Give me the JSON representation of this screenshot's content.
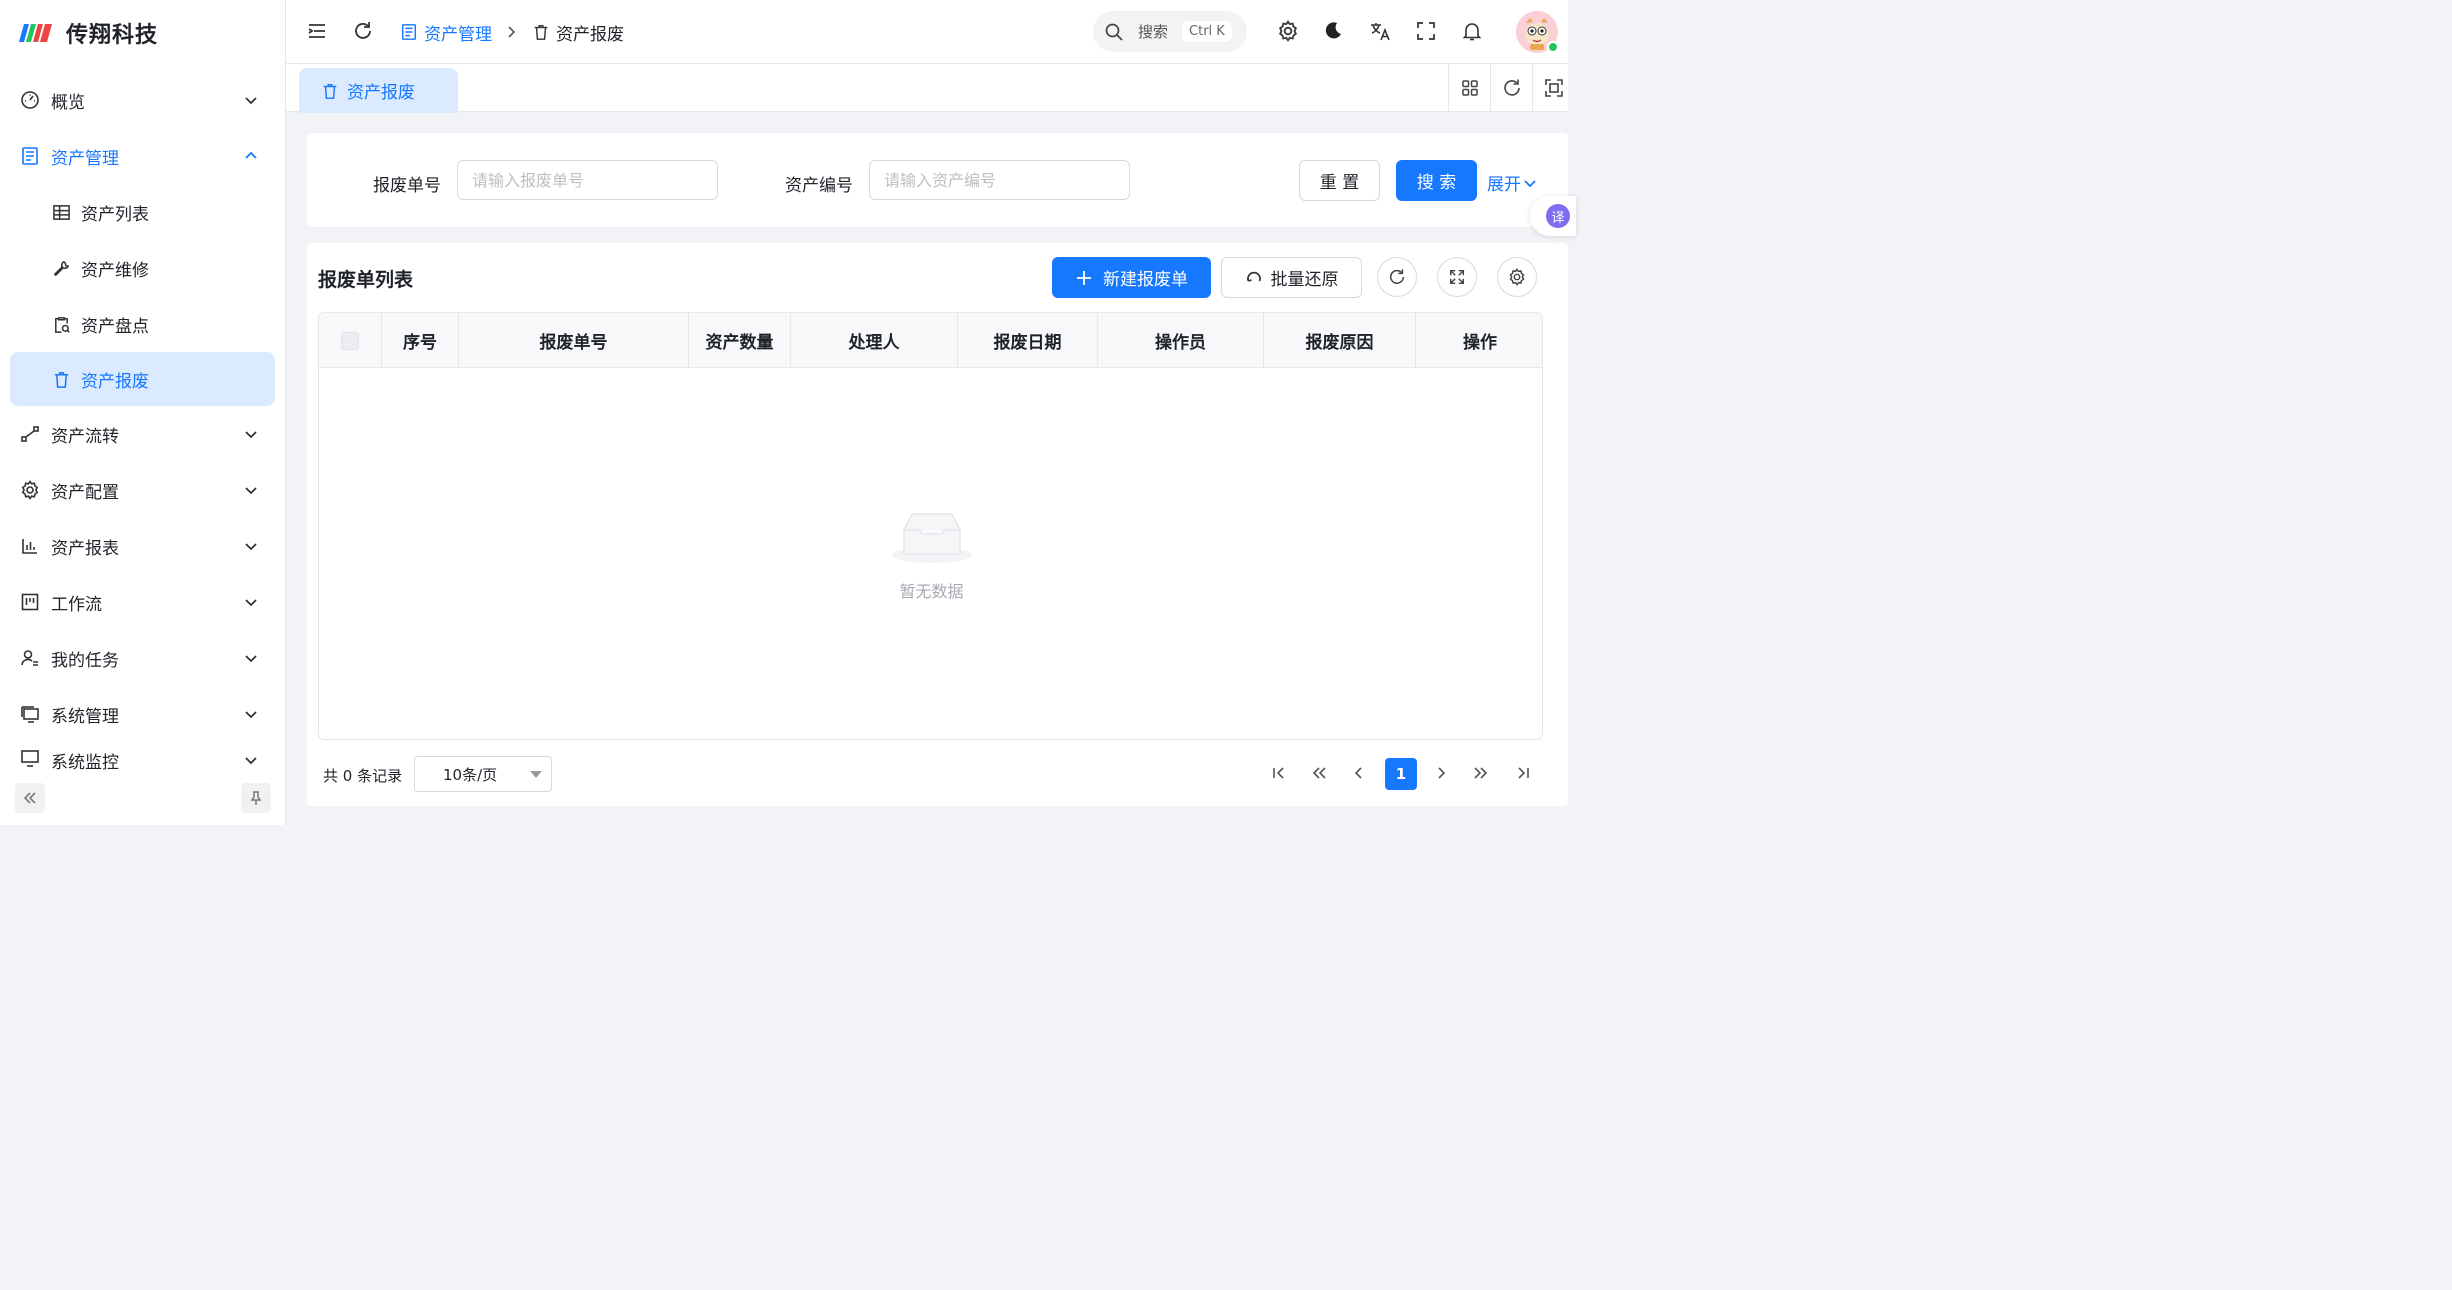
{
  "app": {
    "name": "传翔科技"
  },
  "sidebar": {
    "items": [
      {
        "label": "概览",
        "icon": "dashboard-icon"
      },
      {
        "label": "资产管理",
        "icon": "document-icon",
        "open": true,
        "children": [
          {
            "label": "资产列表",
            "icon": "table-icon"
          },
          {
            "label": "资产维修",
            "icon": "wrench-icon"
          },
          {
            "label": "资产盘点",
            "icon": "clipboard-search-icon"
          },
          {
            "label": "资产报废",
            "icon": "trash-icon",
            "active": true
          }
        ]
      },
      {
        "label": "资产流转",
        "icon": "transfer-icon"
      },
      {
        "label": "资产配置",
        "icon": "gear-icon"
      },
      {
        "label": "资产报表",
        "icon": "bar-chart-icon"
      },
      {
        "label": "工作流",
        "icon": "kanban-icon"
      },
      {
        "label": "我的任务",
        "icon": "user-task-icon"
      },
      {
        "label": "系统管理",
        "icon": "monitor-icon"
      },
      {
        "label": "系统监控",
        "icon": "monitor-icon"
      }
    ]
  },
  "header": {
    "breadcrumb": [
      {
        "label": "资产管理",
        "icon": "document-icon"
      },
      {
        "label": "资产报废",
        "icon": "trash-icon"
      }
    ],
    "search": {
      "label": "搜索",
      "shortcut": "Ctrl K"
    }
  },
  "tabs": [
    {
      "label": "资产报废",
      "icon": "trash-icon",
      "active": true
    }
  ],
  "filters": {
    "scrap_no": {
      "label": "报废单号",
      "placeholder": "请输入报废单号",
      "value": ""
    },
    "asset_no": {
      "label": "资产编号",
      "placeholder": "请输入资产编号",
      "value": ""
    },
    "reset_label": "重 置",
    "search_label": "搜 索",
    "expand_label": "展开"
  },
  "translate_fab": {
    "label": "译"
  },
  "table": {
    "title": "报废单列表",
    "new_label": "新建报废单",
    "batch_restore_label": "批量还原",
    "columns": [
      "序号",
      "报废单号",
      "资产数量",
      "处理人",
      "报废日期",
      "操作员",
      "报废原因",
      "操作"
    ],
    "rows": [],
    "empty_text": "暂无数据"
  },
  "pagination": {
    "total_text": "共 0 条记录",
    "page_size": "10条/页",
    "current_page": "1"
  },
  "colors": {
    "primary": "#1677ff",
    "active_bg": "#dbeafe"
  }
}
